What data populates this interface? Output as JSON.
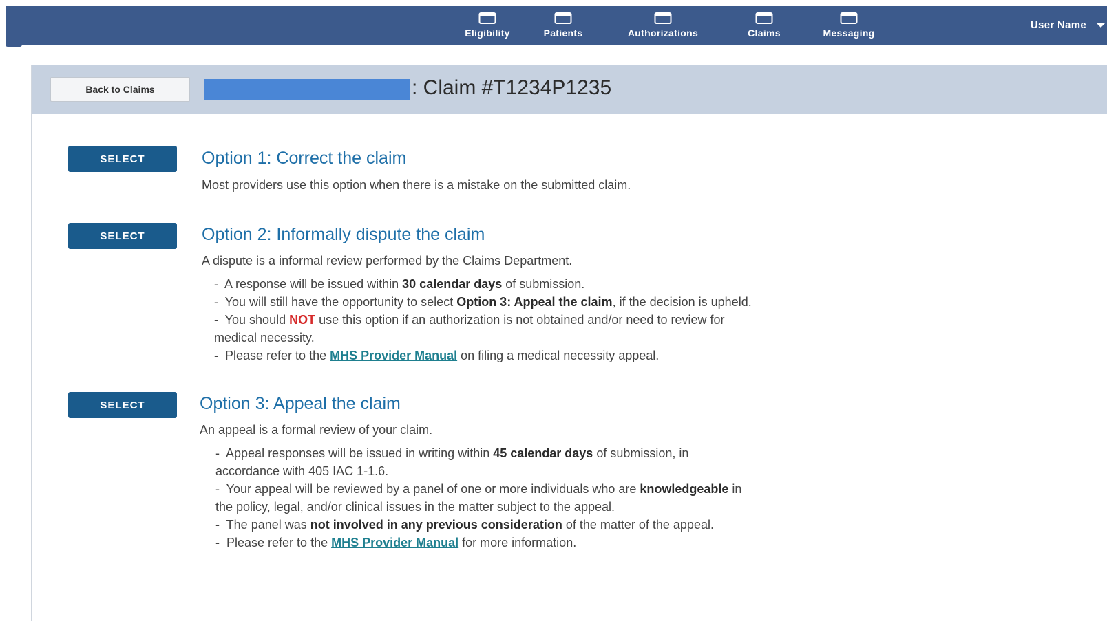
{
  "nav": {
    "items": [
      {
        "label": "Eligibility",
        "icon": "eligibility-icon"
      },
      {
        "label": "Patients",
        "icon": "patients-icon"
      },
      {
        "label": "Authorizations",
        "icon": "authorizations-icon"
      },
      {
        "label": "Claims",
        "icon": "claims-icon"
      },
      {
        "label": "Messaging",
        "icon": "messaging-icon"
      }
    ],
    "user_name": "User Name"
  },
  "header": {
    "back_label": "Back to Claims",
    "claim_title": ": Claim #T1234P1235"
  },
  "options": [
    {
      "select_label": "SELECT",
      "title": "Option 1: Correct the claim",
      "description": "Most providers use this option when there is a mistake on the submitted claim."
    },
    {
      "select_label": "SELECT",
      "title": "Option 2: Informally dispute the claim",
      "description": "A dispute is a informal review performed by the Claims Department.",
      "bullets": [
        {
          "pre": "A response will be issued within ",
          "bold": "30 calendar days",
          "post": " of submission."
        },
        {
          "pre": "You will still have the opportunity to select ",
          "bold": "Option 3: Appeal the claim",
          "post": ", if the decision is upheld."
        },
        {
          "pre": "You should ",
          "red": "NOT",
          "post": " use this option if an authorization is not obtained and/or need to review for",
          "cont": "medical necessity."
        },
        {
          "pre": "Please refer to the ",
          "link": "MHS Provider Manual",
          "post": " on filing a medical necessity appeal."
        }
      ]
    },
    {
      "select_label": "SELECT",
      "title": "Option 3: Appeal the claim",
      "description": "An appeal is a formal review of your claim.",
      "bullets": [
        {
          "pre": "Appeal responses will be issued in writing within ",
          "bold": "45 calendar days",
          "post": " of submission, in",
          "cont": "accordance with 405 IAC 1-1.6."
        },
        {
          "pre": "Your appeal will be reviewed by a panel of one or more individuals who are ",
          "bold": "knowledgeable",
          "post": " in",
          "cont": "the policy, legal, and/or clinical issues in the matter subject to the appeal."
        },
        {
          "pre": "The panel was ",
          "bold": "not involved in any previous consideration",
          "post": " of the matter of the appeal."
        },
        {
          "pre": "Please refer to the ",
          "link": "MHS Provider Manual",
          "post": " for more information."
        }
      ]
    }
  ],
  "colors": {
    "topbar": "#3c5a8c",
    "header_band": "#c6d1e0",
    "select_button": "#1a5b8c",
    "option_title": "#1e6fa8",
    "link": "#1e7f8f",
    "warning": "#d62b2b",
    "redaction": "#4a86d6"
  }
}
